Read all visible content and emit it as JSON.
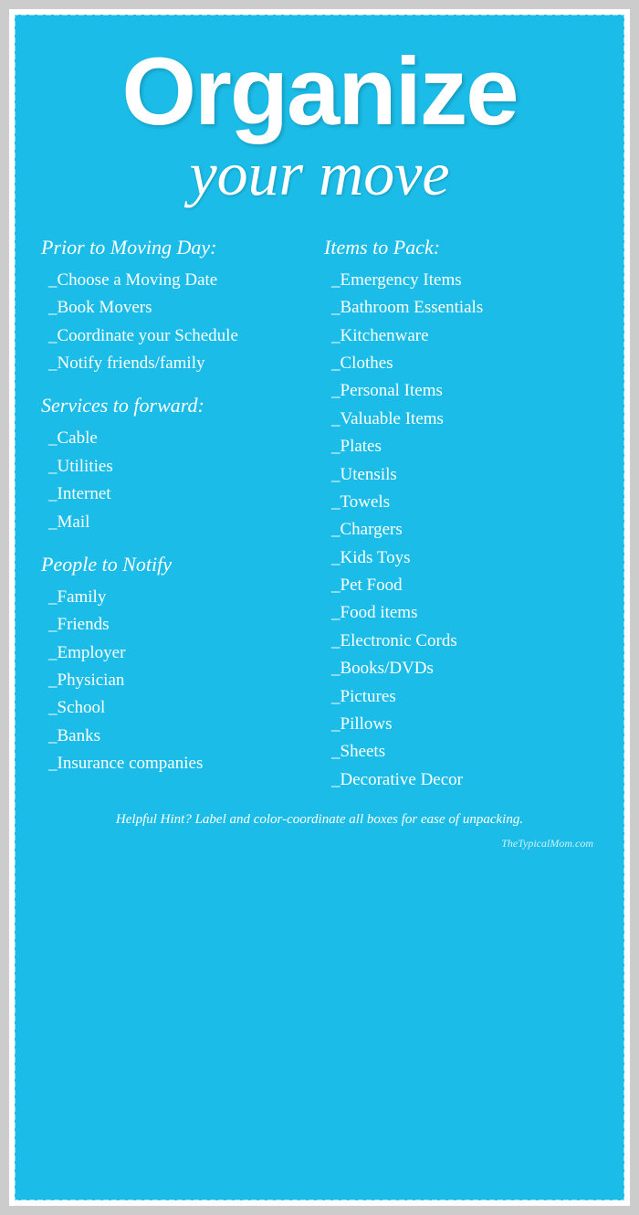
{
  "title": {
    "line1": "Organize",
    "line2": "your move"
  },
  "left": {
    "sections": [
      {
        "heading": "Prior to Moving Day:",
        "items": [
          "_Choose a Moving Date",
          "_Book Movers",
          "_Coordinate your Schedule",
          "_Notify friends/family"
        ]
      },
      {
        "heading": "Services to forward:",
        "items": [
          "_Cable",
          "_Utilities",
          "_Internet",
          "_Mail"
        ]
      },
      {
        "heading": "People to Notify",
        "items": [
          "_Family",
          "_Friends",
          "_Employer",
          "_Physician",
          "_School",
          "_Banks",
          "_Insurance companies"
        ]
      }
    ]
  },
  "right": {
    "sections": [
      {
        "heading": "Items to Pack:",
        "items": [
          "_Emergency Items",
          "_Bathroom  Essentials",
          "_Kitchenware",
          "_Clothes",
          "_Personal  Items",
          "_Valuable  Items",
          "_Plates",
          "_Utensils",
          "_Towels",
          "_Chargers",
          "_Kids  Toys",
          "_Pet Food",
          "_Food items",
          "_Electronic Cords",
          "_Books/DVDs",
          "_Pictures",
          "_Pillows",
          "_Sheets",
          "_Decorative  Decor"
        ]
      }
    ]
  },
  "hint": "Helpful Hint?  Label and color-coordinate all boxes for ease of unpacking.",
  "watermark": "TheTypicalMom.com"
}
